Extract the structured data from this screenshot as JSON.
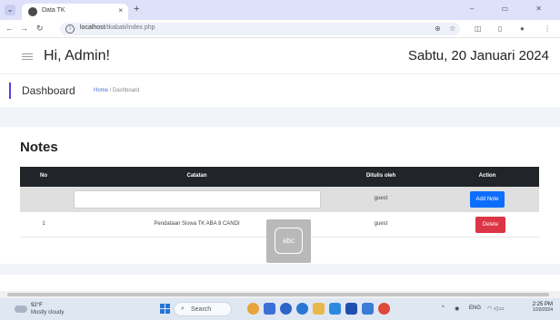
{
  "browser": {
    "tab_title": "Data TK",
    "tab_close": "×",
    "new_tab": "+",
    "window_controls": "–  ▭  ✕",
    "url_host": "localhost",
    "url_path": "/tkabati/index.php"
  },
  "header": {
    "greeting": "Hi, Admin!",
    "date": "Sabtu, 20 Januari 2024"
  },
  "breadcrumb": {
    "title": "Dashboard",
    "home": "Home",
    "separator": " / ",
    "current": "Dashboard"
  },
  "notes": {
    "title": "Notes",
    "columns": [
      "No",
      "Catatan",
      "Ditulis oleh",
      "Action"
    ],
    "form_row": {
      "note_value": "",
      "author": "guest",
      "button": "Add Note"
    },
    "rows": [
      {
        "no": "1",
        "note": "Pendataan Siswa TK ABA 8 CANDI",
        "author": "guest",
        "action": "Delete"
      }
    ]
  },
  "overlay": {
    "label": "abc"
  },
  "taskbar": {
    "temp": "92°F",
    "weather": "Mostly cloudy",
    "search": "Search",
    "lang": "ENG",
    "time": "2:25 PM",
    "date": "1/20/2024"
  },
  "colors": {
    "accent": "#5b3fd8",
    "table_header": "#212529",
    "primary": "#0d6efd",
    "danger": "#dc3545"
  }
}
